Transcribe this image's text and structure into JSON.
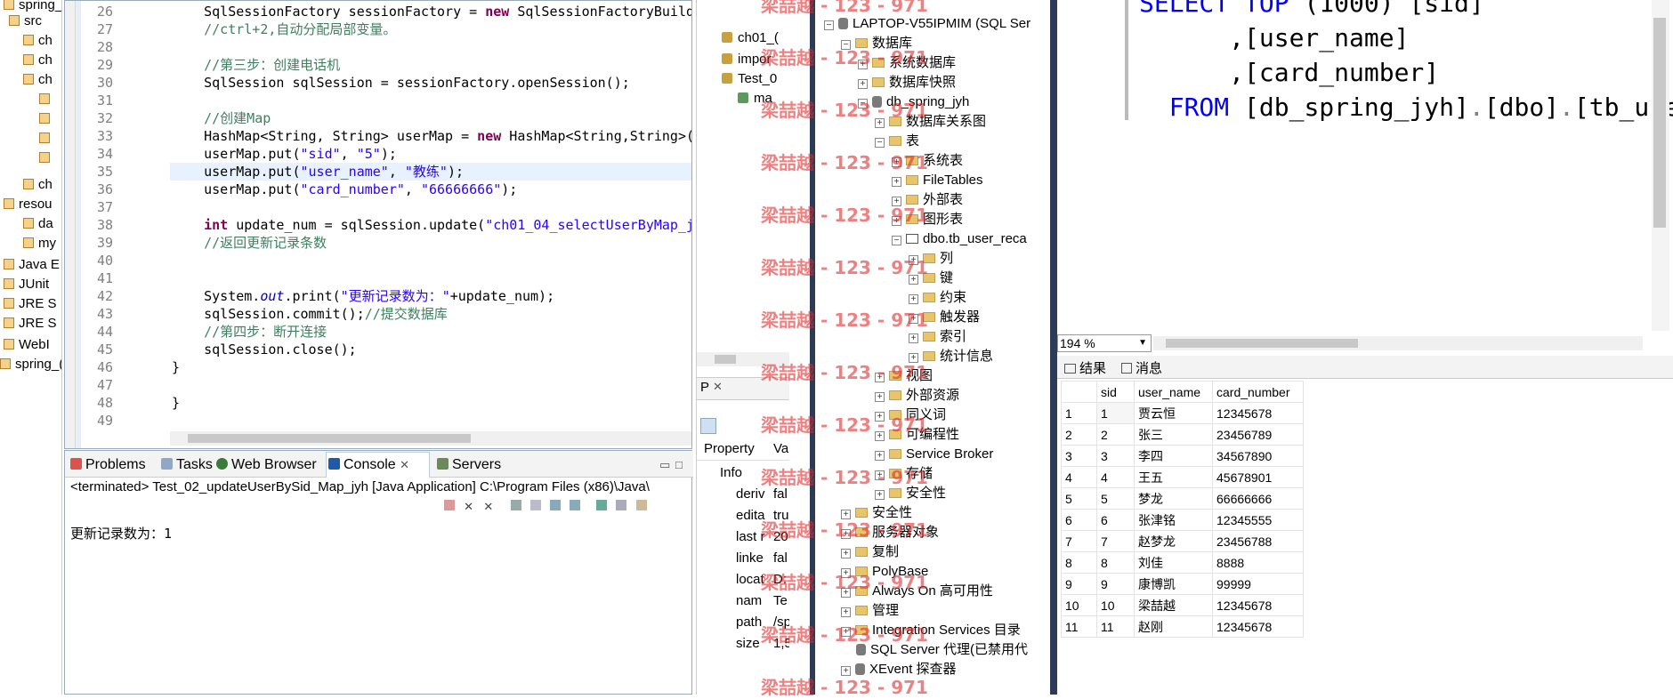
{
  "package_explorer": {
    "items": [
      "spring_",
      "src",
      "ch",
      "ch",
      "ch",
      "",
      "",
      "",
      "",
      "ch",
      "resou",
      "da",
      "my",
      "Java E",
      "JUnit",
      "JRE S",
      "JRE S",
      "WebI",
      "spring_("
    ]
  },
  "editor": {
    "lines": [
      {
        "n": "26",
        "code": [
          {
            "t": "    SqlSessionFactory sessionFactory = ",
            "c": ""
          },
          {
            "t": "new",
            "c": "kw"
          },
          {
            "t": " SqlSessionFactoryBuilde",
            "c": ""
          }
        ]
      },
      {
        "n": "27",
        "code": [
          {
            "t": "    //ctrl+2,自动分配局部变量。",
            "c": "cm"
          }
        ]
      },
      {
        "n": "28",
        "code": []
      },
      {
        "n": "29",
        "code": [
          {
            "t": "    //第三步：创建电话机",
            "c": "cm"
          }
        ]
      },
      {
        "n": "30",
        "code": [
          {
            "t": "    SqlSession sqlSession = sessionFactory.openSession();",
            "c": ""
          }
        ]
      },
      {
        "n": "31",
        "code": []
      },
      {
        "n": "32",
        "code": [
          {
            "t": "    //创建Map",
            "c": "cm"
          }
        ]
      },
      {
        "n": "33",
        "code": [
          {
            "t": "    HashMap<String, String> userMap = ",
            "c": ""
          },
          {
            "t": "new",
            "c": "kw"
          },
          {
            "t": " HashMap<String,String>(",
            "c": ""
          }
        ]
      },
      {
        "n": "34",
        "code": [
          {
            "t": "    userMap.put(",
            "c": ""
          },
          {
            "t": "\"sid\"",
            "c": "st"
          },
          {
            "t": ", ",
            "c": ""
          },
          {
            "t": "\"5\"",
            "c": "st"
          },
          {
            "t": ");",
            "c": ""
          }
        ]
      },
      {
        "n": "35",
        "code": [
          {
            "t": "    userMap.put(",
            "c": ""
          },
          {
            "t": "\"user_name\"",
            "c": "st"
          },
          {
            "t": ", ",
            "c": ""
          },
          {
            "t": "\"教练\"",
            "c": "st"
          },
          {
            "t": ");",
            "c": ""
          }
        ]
      },
      {
        "n": "36",
        "code": [
          {
            "t": "    userMap.put(",
            "c": ""
          },
          {
            "t": "\"card_number\"",
            "c": "st"
          },
          {
            "t": ", ",
            "c": ""
          },
          {
            "t": "\"66666666\"",
            "c": "st"
          },
          {
            "t": ");",
            "c": ""
          }
        ]
      },
      {
        "n": "37",
        "code": []
      },
      {
        "n": "38",
        "code": [
          {
            "t": "    ",
            "c": ""
          },
          {
            "t": "int",
            "c": "kw"
          },
          {
            "t": " update_num = sqlSession.update(",
            "c": ""
          },
          {
            "t": "\"ch01_04_selectUserByMap_jy",
            "c": "st"
          }
        ]
      },
      {
        "n": "39",
        "code": [
          {
            "t": "    //返回更新记录条数",
            "c": "cm"
          }
        ]
      },
      {
        "n": "40",
        "code": []
      },
      {
        "n": "41",
        "code": []
      },
      {
        "n": "42",
        "code": [
          {
            "t": "    System.",
            "c": ""
          },
          {
            "t": "out",
            "c": "it"
          },
          {
            "t": ".print(",
            "c": ""
          },
          {
            "t": "\"更新记录数为：\"",
            "c": "st"
          },
          {
            "t": "+update_num);",
            "c": ""
          }
        ]
      },
      {
        "n": "43",
        "code": [
          {
            "t": "    sqlSession.commit();",
            "c": ""
          },
          {
            "t": "//提交数据库",
            "c": "cm"
          }
        ]
      },
      {
        "n": "44",
        "code": [
          {
            "t": "    //第四步：断开连接",
            "c": "cm"
          }
        ]
      },
      {
        "n": "45",
        "code": [
          {
            "t": "    sqlSession.close();",
            "c": ""
          }
        ]
      },
      {
        "n": "46",
        "code": [
          {
            "t": "}",
            "c": ""
          }
        ]
      },
      {
        "n": "47",
        "code": []
      },
      {
        "n": "48",
        "code": [
          {
            "t": "}",
            "c": ""
          }
        ]
      },
      {
        "n": "49",
        "code": []
      }
    ]
  },
  "console": {
    "tabs": [
      "Problems",
      "Tasks",
      "Web Browser",
      "Console",
      "Servers"
    ],
    "header": "<terminated> Test_02_updateUserBySid_Map_jyh [Java Application] C:\\Program Files (x86)\\Java\\",
    "output": "更新记录数为：1"
  },
  "middle": {
    "top_items": [
      "ch01_(",
      "impor",
      "Test_0",
      "ma"
    ],
    "prop_tab": "P",
    "prop_header": {
      "property": "Property",
      "value": "Va"
    },
    "prop_rows": [
      {
        "k": "Info",
        "v": ""
      },
      {
        "k": "deriv",
        "v": "fal"
      },
      {
        "k": "edita",
        "v": "tru"
      },
      {
        "k": "last r",
        "v": "20"
      },
      {
        "k": "linke",
        "v": "fal"
      },
      {
        "k": "locat",
        "v": "D:"
      },
      {
        "k": "nam",
        "v": "Te"
      },
      {
        "k": "path",
        "v": "/sp"
      },
      {
        "k": "size",
        "v": "1,5"
      }
    ]
  },
  "object_explorer": {
    "items": [
      {
        "label": "LAPTOP-V55IPMIM (SQL Ser",
        "indent": 0,
        "exp": "−",
        "icon": "server"
      },
      {
        "label": "数据库",
        "indent": 1,
        "exp": "−",
        "icon": "folder"
      },
      {
        "label": "系统数据库",
        "indent": 2,
        "exp": "+",
        "icon": "folder"
      },
      {
        "label": "数据库快照",
        "indent": 2,
        "exp": "+",
        "icon": "folder"
      },
      {
        "label": "db_spring_jyh",
        "indent": 2,
        "exp": "−",
        "icon": "db"
      },
      {
        "label": "数据库关系图",
        "indent": 3,
        "exp": "+",
        "icon": "folder"
      },
      {
        "label": "表",
        "indent": 3,
        "exp": "−",
        "icon": "folder"
      },
      {
        "label": "系统表",
        "indent": 4,
        "exp": "+",
        "icon": "folder"
      },
      {
        "label": "FileTables",
        "indent": 4,
        "exp": "+",
        "icon": "folder"
      },
      {
        "label": "外部表",
        "indent": 4,
        "exp": "+",
        "icon": "folder"
      },
      {
        "label": "图形表",
        "indent": 4,
        "exp": "+",
        "icon": "folder"
      },
      {
        "label": "dbo.tb_user_reca",
        "indent": 4,
        "exp": "−",
        "icon": "table"
      },
      {
        "label": "列",
        "indent": 5,
        "exp": "+",
        "icon": "folder"
      },
      {
        "label": "键",
        "indent": 5,
        "exp": "+",
        "icon": "folder"
      },
      {
        "label": "约束",
        "indent": 5,
        "exp": "+",
        "icon": "folder"
      },
      {
        "label": "触发器",
        "indent": 5,
        "exp": "+",
        "icon": "folder"
      },
      {
        "label": "索引",
        "indent": 5,
        "exp": "+",
        "icon": "folder"
      },
      {
        "label": "统计信息",
        "indent": 5,
        "exp": "+",
        "icon": "folder"
      },
      {
        "label": "视图",
        "indent": 3,
        "exp": "+",
        "icon": "folder"
      },
      {
        "label": "外部资源",
        "indent": 3,
        "exp": "+",
        "icon": "folder"
      },
      {
        "label": "同义词",
        "indent": 3,
        "exp": "+",
        "icon": "folder"
      },
      {
        "label": "可编程性",
        "indent": 3,
        "exp": "+",
        "icon": "folder"
      },
      {
        "label": "Service Broker",
        "indent": 3,
        "exp": "+",
        "icon": "folder"
      },
      {
        "label": "存储",
        "indent": 3,
        "exp": "+",
        "icon": "folder"
      },
      {
        "label": "安全性",
        "indent": 3,
        "exp": "+",
        "icon": "folder"
      },
      {
        "label": "安全性",
        "indent": 1,
        "exp": "+",
        "icon": "folder"
      },
      {
        "label": "服务器对象",
        "indent": 1,
        "exp": "+",
        "icon": "folder"
      },
      {
        "label": "复制",
        "indent": 1,
        "exp": "+",
        "icon": "folder"
      },
      {
        "label": "PolyBase",
        "indent": 1,
        "exp": "+",
        "icon": "folder"
      },
      {
        "label": "Always On 高可用性",
        "indent": 1,
        "exp": "+",
        "icon": "folder"
      },
      {
        "label": "管理",
        "indent": 1,
        "exp": "+",
        "icon": "folder"
      },
      {
        "label": "Integration Services 目录",
        "indent": 1,
        "exp": "+",
        "icon": "folder"
      },
      {
        "label": "SQL Server 代理(已禁用代",
        "indent": 1,
        "exp": "",
        "icon": "agent"
      },
      {
        "label": "XEvent 探查器",
        "indent": 1,
        "exp": "+",
        "icon": "xevent"
      }
    ]
  },
  "sql_editor": {
    "lines": [
      [
        {
          "t": "SELECT TOP ",
          "c": "sk"
        },
        {
          "t": "(1000) [sid]",
          "c": ""
        }
      ],
      [
        {
          "t": "      ,[user_name]",
          "c": ""
        }
      ],
      [
        {
          "t": "      ,[card_number]",
          "c": ""
        }
      ],
      [
        {
          "t": "  FROM ",
          "c": "sk"
        },
        {
          "t": "[db_spring_jyh]",
          "c": ""
        },
        {
          "t": ".",
          "c": "sg"
        },
        {
          "t": "[dbo]",
          "c": ""
        },
        {
          "t": ".",
          "c": "sg"
        },
        {
          "t": "[tb_use",
          "c": ""
        }
      ]
    ],
    "zoom": "194 %"
  },
  "results": {
    "tabs": [
      "结果",
      "消息"
    ],
    "columns": [
      "sid",
      "user_name",
      "card_number"
    ],
    "rows": [
      [
        "1",
        "1",
        "贾云恒",
        "12345678"
      ],
      [
        "2",
        "2",
        "张三",
        "23456789"
      ],
      [
        "3",
        "3",
        "李四",
        "34567890"
      ],
      [
        "4",
        "4",
        "王五",
        "45678901"
      ],
      [
        "5",
        "5",
        "梦龙",
        "66666666"
      ],
      [
        "6",
        "6",
        "张津铭",
        "12345555"
      ],
      [
        "7",
        "7",
        "赵梦龙",
        "23456788"
      ],
      [
        "8",
        "8",
        "刘佳",
        "8888"
      ],
      [
        "9",
        "9",
        "康博凯",
        "99999"
      ],
      [
        "10",
        "10",
        "梁喆越",
        "12345678"
      ],
      [
        "11",
        "11",
        "赵刚",
        "12345678"
      ]
    ]
  },
  "watermark": "梁喆越 - 123 - 971"
}
